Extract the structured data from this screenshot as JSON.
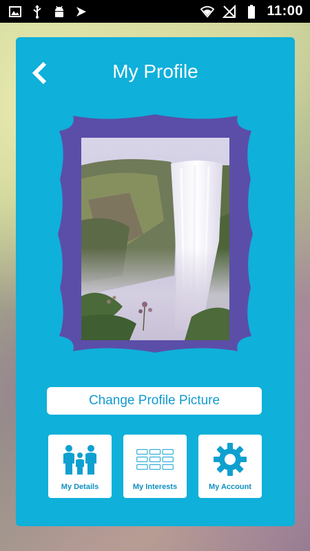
{
  "status_bar": {
    "time": "11:00",
    "left_icons": [
      "image-icon",
      "usb-icon",
      "android-icon",
      "check-flag-icon"
    ],
    "right_icons": [
      "wifi-icon",
      "no-signal-icon",
      "battery-icon"
    ]
  },
  "header": {
    "title": "My Profile",
    "back_icon": "chevron-left-icon"
  },
  "profile_picture": {
    "frame_color": "#5b4ea8",
    "subject": "waterfall"
  },
  "actions": {
    "change_picture_label": "Change Profile Picture"
  },
  "tiles": [
    {
      "label": "My Details",
      "icon": "family-icon"
    },
    {
      "label": "My Interests",
      "icon": "grid-icon"
    },
    {
      "label": "My Account",
      "icon": "gear-icon"
    }
  ],
  "colors": {
    "card": "#0fb0da",
    "accent": "#0f8fc0",
    "frame": "#5b4ea8"
  }
}
